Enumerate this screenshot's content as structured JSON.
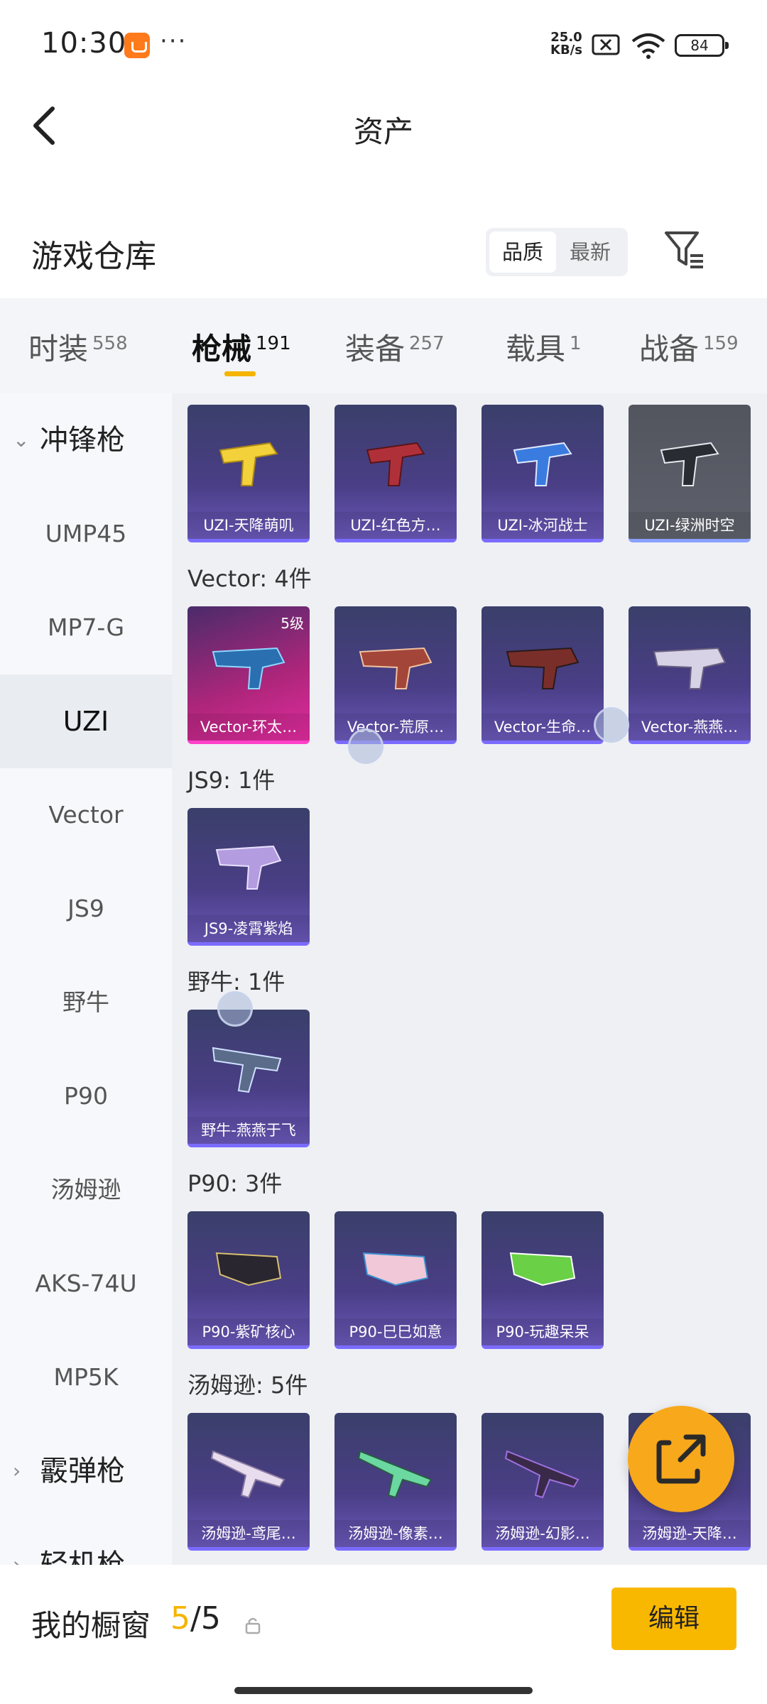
{
  "status": {
    "time": "10:30",
    "speed_value": "25.0",
    "speed_unit": "KB/s",
    "battery": "84"
  },
  "header": {
    "title": "资产"
  },
  "section": {
    "title": "游戏仓库",
    "sort_options": [
      "品质",
      "最新"
    ]
  },
  "category_tabs": [
    {
      "label": "时装",
      "count": "558"
    },
    {
      "label": "枪械",
      "count": "191"
    },
    {
      "label": "装备",
      "count": "257"
    },
    {
      "label": "载具",
      "count": "1"
    },
    {
      "label": "战备",
      "count": "159"
    }
  ],
  "sidebar": {
    "groups": [
      "冲锋枪",
      "霰弹枪",
      "轻机枪"
    ],
    "items": [
      "UMP45",
      "MP7-G",
      "UZI",
      "Vector",
      "JS9",
      "野牛",
      "P90",
      "汤姆逊",
      "AKS-74U",
      "MP5K"
    ]
  },
  "content": {
    "uzi_cards": [
      "UZI-天降萌叽",
      "UZI-红色方…",
      "UZI-冰河战士",
      "UZI-绿洲时空"
    ],
    "vector_title": "Vector: 4件",
    "vector_cards": [
      "Vector-环太…",
      "Vector-荒原…",
      "Vector-生命…",
      "Vector-燕燕…"
    ],
    "vector_level": "5级",
    "js9_title": "JS9: 1件",
    "js9_cards": [
      "JS9-凌霄紫焰"
    ],
    "bison_title": "野牛: 1件",
    "bison_cards": [
      "野牛-燕燕于飞"
    ],
    "p90_title": "P90: 3件",
    "p90_cards": [
      "P90-紫矿核心",
      "P90-巳巳如意",
      "P90-玩趣呆呆"
    ],
    "thompson_title": "汤姆逊: 5件",
    "thompson_cards": [
      "汤姆逊-鸢尾…",
      "汤姆逊-像素…",
      "汤姆逊-幻影…",
      "汤姆逊-天降…"
    ]
  },
  "bottom": {
    "label": "我的橱窗",
    "current": "5",
    "total": "/5",
    "edit": "编辑"
  },
  "colors": {
    "accent": "#f5b400",
    "card_purple": "#4a3e86",
    "card_pink": "#e02c9e"
  },
  "icons": [
    "back-arrow-icon",
    "filter-icon",
    "share-icon",
    "lock-icon"
  ]
}
